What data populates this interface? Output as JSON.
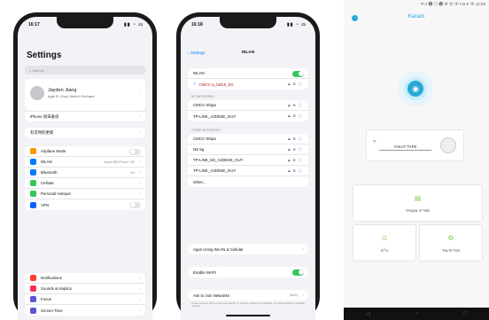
{
  "phone1": {
    "time": "16:17",
    "status_icons": "▮▮ ◔ ▭",
    "title": "Settings",
    "search_placeholder": "Search",
    "profile": {
      "name": "Jayden Jiang",
      "subtitle": "Apple ID, iCloud, Media & Purchases"
    },
    "iphone_row": "iPhone 尚未备份",
    "update_row": "有可用的更新",
    "rows": [
      {
        "label": "Airplane Mode",
        "color": "#ff9500",
        "toggle": "off"
      },
      {
        "label": "WLAN",
        "color": "#007aff",
        "value": "Jayden的 iPhone 13P"
      },
      {
        "label": "Bluetooth",
        "color": "#007aff",
        "value": "On"
      },
      {
        "label": "Cellular",
        "color": "#34c759"
      },
      {
        "label": "Personal Hotspot",
        "color": "#34c759"
      },
      {
        "label": "VPN",
        "color": "#0a60ff",
        "toggle": "off"
      }
    ],
    "rows2": [
      {
        "label": "Notifications",
        "color": "#ff3b30"
      },
      {
        "label": "Sounds & Haptics",
        "color": "#ff2d55"
      },
      {
        "label": "Focus",
        "color": "#5856d6"
      },
      {
        "label": "Screen Time",
        "color": "#5856d6"
      }
    ]
  },
  "phone2": {
    "time": "16:18",
    "back_label": "Settings",
    "title": "WLAN",
    "wlan_label": "WLAN",
    "connected_network": "CMCC-a_b6f19_5G",
    "my_networks_header": "MY NETWORKS",
    "my_networks": [
      "CMCC-Shipa",
      "TP-LINK_A2DD4E_GUY"
    ],
    "other_networks_header": "OTHER NETWORKS",
    "other_networks": [
      "CMCC-Shipa",
      "NS 5g",
      "TP-LINK_5G_A2DD4E_GUY",
      "TP-LINK_A2DD4E_GUY",
      "Other..."
    ],
    "ask_to_join": "Apps Using WLAN & Cellular",
    "enable_wapi": "Enable WAPI",
    "auto_join": "Ask to Join Networks",
    "auto_join_value": "Notify",
    "footnote": "Known networks will be joined automatically. If no known networks are available, you will be notified of available networks."
  },
  "app": {
    "status_bar": "ᯤ.ıl 🅑 ◎ 🅑 ⊕ ▣ ▣ • ◘ ✦ ⊗ 11:03",
    "title": "Kacam",
    "device_name": "YAKAT TAPE",
    "tiles": [
      {
        "label": "ספרייה מקומית",
        "icon": "▤"
      },
      {
        "label": "ט״ס",
        "icon": "⊙"
      },
      {
        "label": "הגדרות ציוד",
        "icon": "⚙"
      }
    ],
    "brand_color": "#29a8d8"
  }
}
